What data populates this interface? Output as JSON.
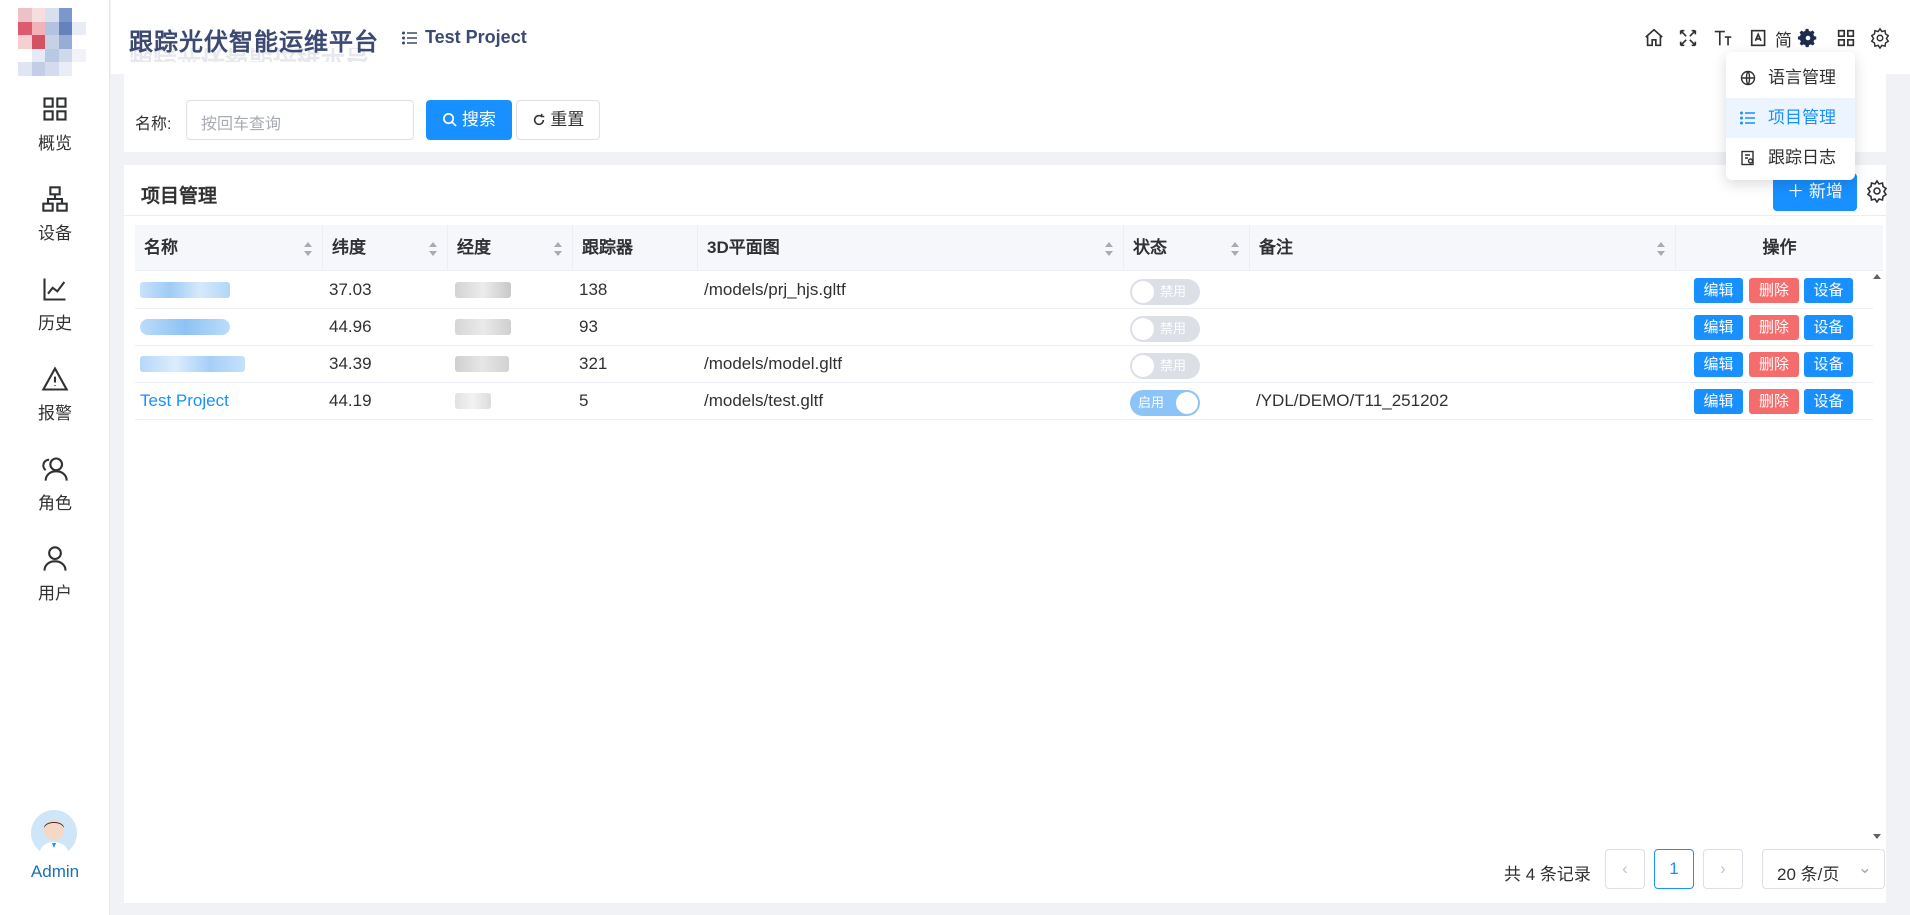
{
  "header": {
    "app_title": "跟踪光伏智能运维平台",
    "project_name": "Test Project",
    "lang_label": "简"
  },
  "sidebar": {
    "items": [
      {
        "label": "概览",
        "icon": "grid-icon"
      },
      {
        "label": "设备",
        "icon": "device-tree-icon"
      },
      {
        "label": "历史",
        "icon": "chart-line-icon"
      },
      {
        "label": "报警",
        "icon": "warning-icon"
      },
      {
        "label": "角色",
        "icon": "roles-icon"
      },
      {
        "label": "用户",
        "icon": "user-icon"
      }
    ],
    "user_name": "Admin"
  },
  "search": {
    "label": "名称:",
    "placeholder": "按回车查询",
    "search_btn": "搜索",
    "reset_btn": "重置"
  },
  "panel": {
    "title": "项目管理",
    "add_btn": "新增"
  },
  "table": {
    "columns": [
      "名称",
      "纬度",
      "经度",
      "跟踪器",
      "3D平面图",
      "状态",
      "备注",
      "操作"
    ],
    "rows": [
      {
        "name": "",
        "lat": "37.03",
        "trackers": "138",
        "model": "/models/prj_hjs.gltf",
        "status": "禁用",
        "enabled": false,
        "note": ""
      },
      {
        "name": "",
        "lat": "44.96",
        "trackers": "93",
        "model": "",
        "status": "禁用",
        "enabled": false,
        "note": ""
      },
      {
        "name": "",
        "lat": "34.39",
        "trackers": "321",
        "model": "/models/model.gltf",
        "status": "禁用",
        "enabled": false,
        "note": ""
      },
      {
        "name": "Test Project",
        "lat": "44.19",
        "trackers": "5",
        "model": "/models/test.gltf",
        "status": "启用",
        "enabled": true,
        "note": "/YDL/DEMO/T11_251202"
      }
    ],
    "actions": {
      "edit": "编辑",
      "delete": "删除",
      "devices": "设备"
    }
  },
  "pagination": {
    "total_text": "共 4 条记录",
    "current_page": "1",
    "page_size": "20 条/页"
  },
  "dropdown": {
    "items": [
      "语言管理",
      "项目管理",
      "跟踪日志"
    ],
    "active": "项目管理"
  },
  "colors": {
    "primary": "#1890ff",
    "danger": "#f56c6c",
    "title": "#3c4a73"
  }
}
